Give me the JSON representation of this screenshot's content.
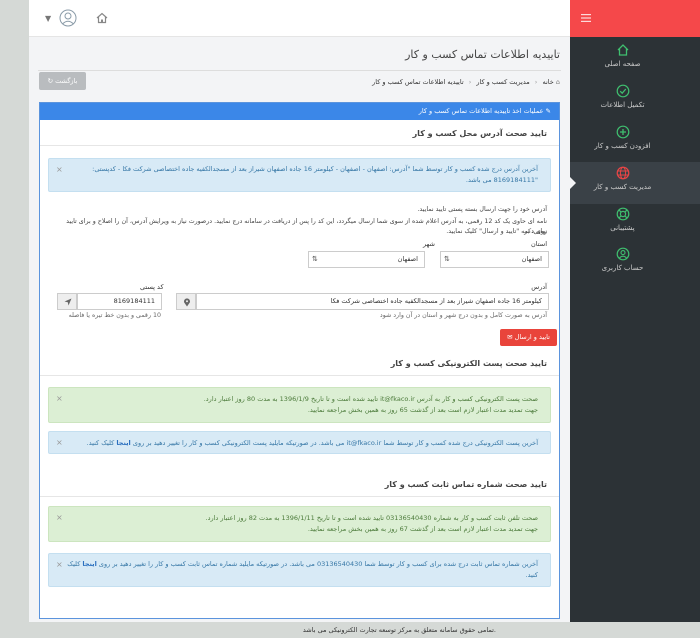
{
  "sidebar": {
    "items": [
      {
        "label": "صفحه اصلی",
        "icon": "home-icon"
      },
      {
        "label": "تکمیل اطلاعات",
        "icon": "check-circle-icon"
      },
      {
        "label": "افزودن کسب و کار",
        "icon": "plus-circle-icon"
      },
      {
        "label": "مدیریت کسب و کار",
        "icon": "globe-icon"
      },
      {
        "label": "پشتیبانی",
        "icon": "lifebuoy-icon"
      },
      {
        "label": "حساب کاربری",
        "icon": "user-icon"
      }
    ]
  },
  "page": {
    "title": "تاییدیه اطلاعات تماس کسب و کار",
    "back_label": "بازگشت",
    "breadcrumb": [
      "خانه",
      "مدیریت کسب و کار",
      "تاییدیه اطلاعات تماس کسب و کار"
    ]
  },
  "panel": {
    "header": "عملیات اخذ تاییدیه اطلاعات تماس کسب و کار",
    "address_section": {
      "title": "تایید صحت آدرس محل کسب و کار",
      "alert_line1": "آخرین آدرس درج شده کسب و کار توسط شما \"آدرس: اصفهان - اصفهان - کیلومتر 16 جاده اصفهان شیراز بعد از مسجدالکفیه جاده اختصاصی شرکت فکا - کدپستی:",
      "alert_line2": "\"8169184111 می باشد.",
      "instr1": "آدرس خود را جهت ارسال بسته پستی تایید نمایید.",
      "instr2": "نامه ای حاوی یک کد 12 رقمی، به آدرس اعلام شده از سوی شما ارسال میگردد، این کد را پس از دریافت در سامانه درج نمایید. درصورت نیاز به ویرایش آدرس، آن را اصلاح و برای تایید نهایی، بر",
      "instr3": "روی دکمه \"تایید و ارسال\" کلیک نمایید.",
      "province_label": "استان",
      "province_value": "اصفهان",
      "city_label": "شهر",
      "city_value": "اصفهان",
      "address_label": "آدرس",
      "address_value": "کیلومتر 16 جاده اصفهان شیراز بعد از مسجدالکفیه جاده اختصاصی شرکت فکا",
      "address_hint": "آدرس به صورت کامل و بدون درج شهر و استان در آن وارد شود",
      "postal_label": "کد پستی",
      "postal_value": "8169184111",
      "postal_hint": "10 رقمی و بدون خط تیره یا فاصله",
      "submit_label": "تایید و ارسال"
    },
    "email_section": {
      "title": "تایید صحت پست الکترونیکی کسب و کار",
      "success_line1": "صحت پست الکترونیکی کسب و کار به آدرس it@fkaco.ir تایید شده است و تا تاریخ 1396/1/9 به مدت 80 روز اعتبار دارد.",
      "success_line2": "جهت تمدید مدت اعتبار لازم است بعد از گذشت 65 روز به همین بخش مراجعه نمایید.",
      "info_text": "آخرین پست الکترونیکی درج شده کسب و کار توسط شما it@fkaco.ir می باشد. در صورتیکه مایلید پست الکترونیکی کسب و کار را تغییر دهید بر روی",
      "info_link": "اینجا",
      "info_tail": "کلیک کنید."
    },
    "phone_section": {
      "title": "تایید صحت شماره تماس ثابت کسب و کار",
      "success_line1": "صحت تلفن ثابت کسب و کار به شماره 03136540430 تایید شده است و تا تاریخ 1396/1/11 به مدت 82 روز اعتبار دارد.",
      "success_line2": "جهت تمدید مدت اعتبار لازم است بعد از گذشت 67 روز به همین بخش مراجعه نمایید.",
      "info_text": "آخرین شماره تماس ثابت درج شده برای کسب و کار توسط شما 03136540430 می باشد. در صورتیکه مایلید شماره تماس ثابت کسب و کار را تغییر دهید بر روی",
      "info_link": "اینجا",
      "info_tail": "کلیک",
      "info_line2": "کنید."
    }
  },
  "footer": {
    "text": "تمامی حقوق سامانه متعلق به مرکز توسعه تجارت الکترونیکی می باشد."
  },
  "colors": {
    "accent_red": "#f5484a",
    "panel_blue": "#3b87e8",
    "sidebar_dark": "#2c3236",
    "icon_green": "#3fbf6f"
  }
}
